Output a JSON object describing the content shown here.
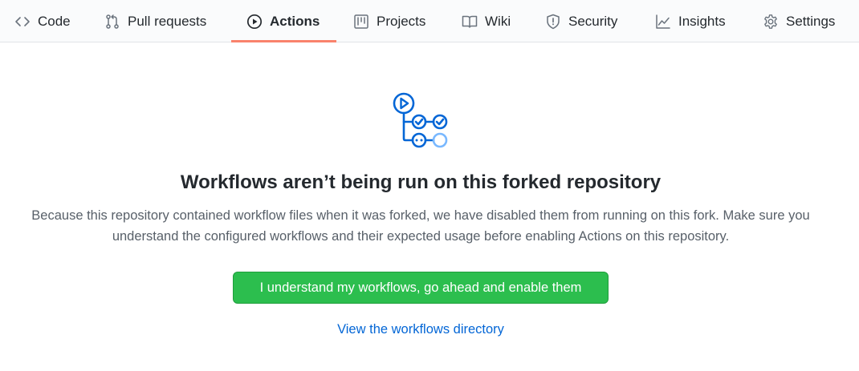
{
  "tabs": [
    {
      "label": "Code",
      "icon": "code-icon"
    },
    {
      "label": "Pull requests",
      "icon": "pull-request-icon"
    },
    {
      "label": "Actions",
      "icon": "play-icon",
      "active": true
    },
    {
      "label": "Projects",
      "icon": "project-icon"
    },
    {
      "label": "Wiki",
      "icon": "book-icon"
    },
    {
      "label": "Security",
      "icon": "shield-icon"
    },
    {
      "label": "Insights",
      "icon": "graph-icon"
    },
    {
      "label": "Settings",
      "icon": "gear-icon"
    }
  ],
  "main": {
    "title": "Workflows aren’t being run on this forked repository",
    "description": "Because this repository contained workflow files when it was forked, we have disabled them from running on this fork. Make sure you understand the configured workflows and their expected usage before enabling Actions on this repository.",
    "enable_button": "I understand my workflows, go ahead and enable them",
    "workflows_link": "View the workflows directory",
    "hero_icon": "workflow-icon"
  },
  "colors": {
    "accent_underline": "#f9826c",
    "primary_button": "#2cbe4e",
    "link": "#0366d6",
    "icon_blue": "#0366d6"
  }
}
